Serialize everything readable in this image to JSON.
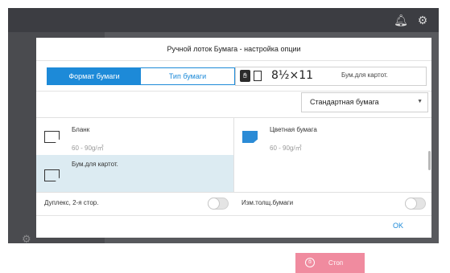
{
  "header": {
    "bell_icon": "bell-icon",
    "settings_icon": "gear-icon"
  },
  "background": {
    "left_label": "",
    "mid_label": ""
  },
  "dialog": {
    "title": "Ручной лоток Бумага - настройка опции",
    "tabs": [
      {
        "label": "Формат бумаги",
        "active": true
      },
      {
        "label": "Тип бумаги",
        "active": false
      }
    ],
    "current": {
      "size": "8½×11",
      "type": "Бум.для картот."
    },
    "dropdown": {
      "selected": "Стандартная бумага"
    },
    "paper_types": [
      {
        "name": "Бланк",
        "weight": "60 - 90g/㎡",
        "selected": false,
        "color": "white"
      },
      {
        "name": "Цветная бумага",
        "weight": "60 - 90g/㎡",
        "selected": false,
        "color": "blue"
      },
      {
        "name": "Бум.для картот.",
        "weight": "",
        "selected": true,
        "color": "white"
      },
      {
        "name": "",
        "weight": "",
        "selected": false,
        "color": "none"
      }
    ],
    "toggles": [
      {
        "label": "Дуплекс, 2-я стор.",
        "on": false
      },
      {
        "label": "Изм.толщ.бумаги",
        "on": false
      }
    ],
    "ok_label": "OK"
  },
  "stop": {
    "label": "Стоп"
  },
  "colors": {
    "accent": "#1d8ad8",
    "selected_row": "#dcebf2",
    "stop": "#f08b9f",
    "topbar": "#3c3d42"
  }
}
